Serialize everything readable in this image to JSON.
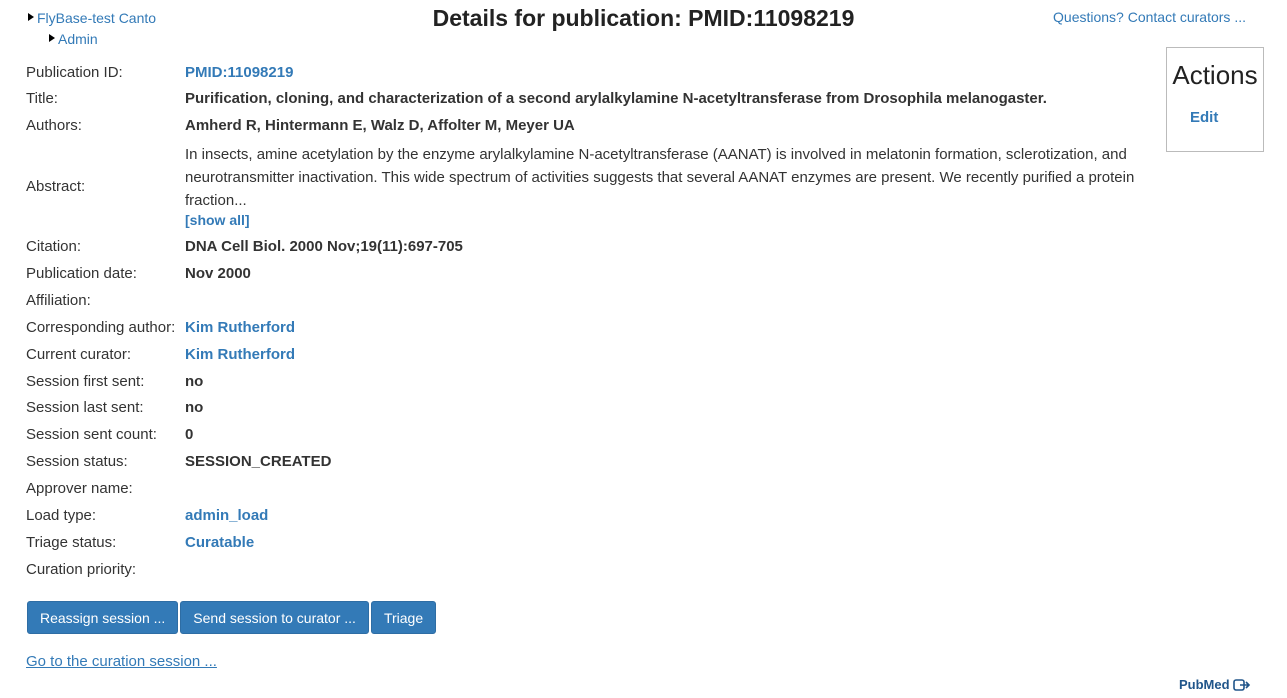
{
  "breadcrumbs": [
    "FlyBase-test Canto",
    "Admin"
  ],
  "page_title": "Details for publication: PMID:11098219",
  "contact_link": "Questions? Contact curators ...",
  "details": [
    {
      "label": "Publication ID:",
      "value": "PMID:11098219",
      "type": "link"
    },
    {
      "label": "Title:",
      "value": "Purification, cloning, and characterization of a second arylalkylamine N-acetyltransferase from Drosophila melanogaster.",
      "type": "text"
    },
    {
      "label": "Authors:",
      "value": "Amherd R, Hintermann E, Walz D, Affolter M, Meyer UA",
      "type": "text"
    },
    {
      "label": "Abstract:",
      "value": "In insects, amine acetylation by the enzyme arylalkylamine N-acetyltransferase (AANAT) is involved in melatonin formation, sclerotization, and neurotransmitter inactivation. This wide spectrum of activities suggests that several AANAT enzymes are present. We recently purified a protein fraction...",
      "type": "abstract"
    },
    {
      "label": "Citation:",
      "value": "DNA Cell Biol. 2000 Nov;19(11):697-705",
      "type": "text"
    },
    {
      "label": "Publication date:",
      "value": "Nov 2000",
      "type": "text"
    },
    {
      "label": "Affiliation:",
      "value": "",
      "type": "text"
    },
    {
      "label": "Corresponding author:",
      "value": "Kim Rutherford",
      "type": "link"
    },
    {
      "label": "Current curator:",
      "value": "Kim Rutherford",
      "type": "link"
    },
    {
      "label": "Session first sent:",
      "value": "no",
      "type": "text"
    },
    {
      "label": "Session last sent:",
      "value": "no",
      "type": "text"
    },
    {
      "label": "Session sent count:",
      "value": "0",
      "type": "text"
    },
    {
      "label": "Session status:",
      "value": "SESSION_CREATED",
      "type": "text"
    },
    {
      "label": "Approver name:",
      "value": "",
      "type": "text"
    },
    {
      "label": "Load type:",
      "value": "admin_load",
      "type": "link"
    },
    {
      "label": "Triage status:",
      "value": "Curatable",
      "type": "link"
    },
    {
      "label": "Curation priority:",
      "value": "",
      "type": "text"
    }
  ],
  "show_all_label": "[show all]",
  "actions": {
    "title": "Actions",
    "edit_label": "Edit"
  },
  "buttons": [
    "Reassign session ...",
    "Send session to curator ...",
    "Triage"
  ],
  "goto_session": "Go to the curation session ...",
  "pubmed_logo": "PubMed"
}
